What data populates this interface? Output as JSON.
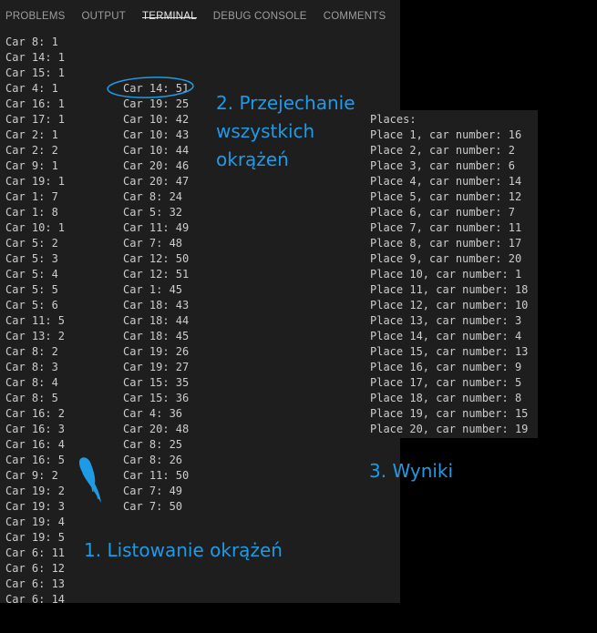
{
  "tabs": [
    {
      "label": "PROBLEMS",
      "active": false
    },
    {
      "label": "OUTPUT",
      "active": false
    },
    {
      "label": "TERMINAL",
      "active": true
    },
    {
      "label": "DEBUG CONSOLE",
      "active": false
    },
    {
      "label": "COMMENTS",
      "active": false
    }
  ],
  "terminal": {
    "column1": [
      "Car 8: 1",
      "Car 14: 1",
      "Car 15: 1",
      "Car 4: 1",
      "Car 16: 1",
      "Car 17: 1",
      "Car 2: 1",
      "Car 2: 2",
      "Car 9: 1",
      "Car 19: 1",
      "Car 1: 7",
      "Car 1: 8",
      "Car 10: 1",
      "Car 5: 2",
      "Car 5: 3",
      "Car 5: 4",
      "Car 5: 5",
      "Car 5: 6",
      "Car 11: 5",
      "Car 13: 2",
      "Car 8: 2",
      "Car 8: 3",
      "Car 8: 4",
      "Car 8: 5",
      "Car 16: 2",
      "Car 16: 3",
      "Car 16: 4",
      "Car 16: 5",
      "Car 9: 2",
      "Car 19: 2",
      "Car 19: 3",
      "Car 19: 4",
      "Car 19: 5",
      "Car 6: 11",
      "Car 6: 12",
      "Car 6: 13",
      "Car 6: 14"
    ],
    "column2": [
      "Car 14: 51",
      "Car 19: 25",
      "Car 10: 42",
      "Car 10: 43",
      "Car 10: 44",
      "Car 20: 46",
      "Car 20: 47",
      "Car 8: 24",
      "Car 5: 32",
      "Car 11: 49",
      "Car 7: 48",
      "Car 12: 50",
      "Car 12: 51",
      "Car 1: 45",
      "Car 18: 43",
      "Car 18: 44",
      "Car 18: 45",
      "Car 19: 26",
      "Car 19: 27",
      "Car 15: 35",
      "Car 15: 36",
      "Car 4: 36",
      "Car 20: 48",
      "Car 8: 25",
      "Car 8: 26",
      "Car 11: 50",
      "Car 7: 49",
      "Car 7: 50"
    ],
    "results": [
      "Places:",
      "Place 1, car number: 16",
      "Place 2, car number: 2",
      "Place 3, car number: 6",
      "Place 4, car number: 14",
      "Place 5, car number: 12",
      "Place 6, car number: 7",
      "Place 7, car number: 11",
      "Place 8, car number: 17",
      "Place 9, car number: 20",
      "Place 10, car number: 1",
      "Place 11, car number: 18",
      "Place 12, car number: 10",
      "Place 13, car number: 3",
      "Place 14, car number: 4",
      "Place 15, car number: 13",
      "Place 16, car number: 9",
      "Place 17, car number: 5",
      "Place 18, car number: 8",
      "Place 19, car number: 15",
      "Place 20, car number: 19"
    ]
  },
  "annotations": {
    "listing": "1. Listowanie okrążeń",
    "all_laps": "2. Przejechanie\nwszystkich\nokrążeń",
    "results": "3. Wyniki"
  },
  "colors": {
    "annotation": "#1e9be6",
    "terminal_bg": "#1e1e1e",
    "terminal_text": "#cccccc"
  }
}
